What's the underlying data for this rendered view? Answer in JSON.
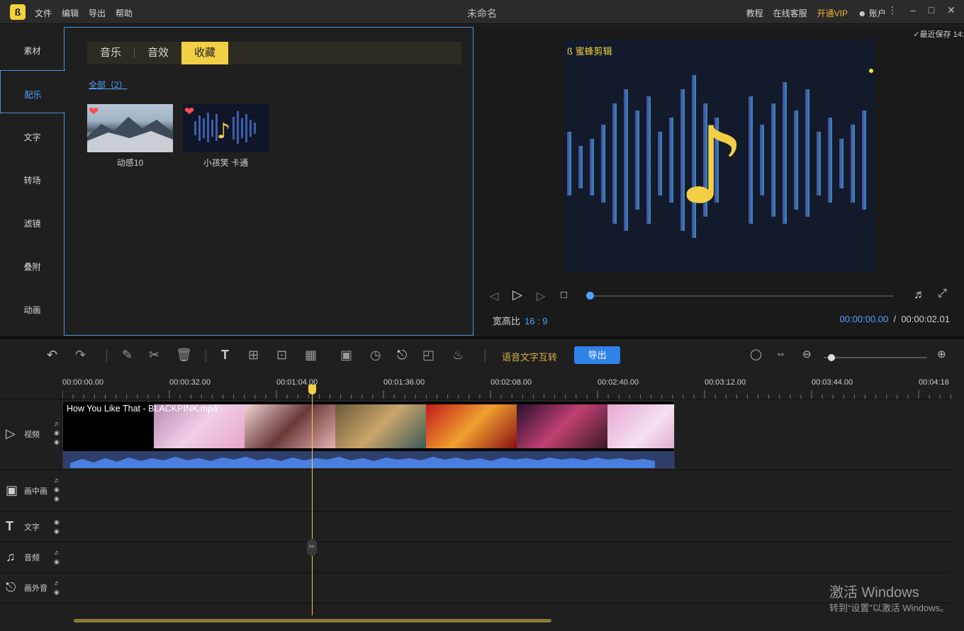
{
  "titlebar": {
    "menu": [
      "文件",
      "编辑",
      "导出",
      "帮助"
    ],
    "title": "未命名",
    "links": [
      "教程",
      "在线客服"
    ],
    "vip": "开通VIP",
    "account": "账户"
  },
  "sidenav": [
    "素材",
    "配乐",
    "文字",
    "转场",
    "滤镜",
    "叠附",
    "动画"
  ],
  "sidenav_active": "配乐",
  "tabs": [
    "音乐",
    "音效",
    "收藏"
  ],
  "tab_active": "收藏",
  "all_link": "全部（2）",
  "cards": [
    {
      "label": "动感10"
    },
    {
      "label": "小孩笑 卡通"
    }
  ],
  "preview": {
    "last_save": "最近保存 14:",
    "watermark": "蜜蜂剪辑",
    "aspect_label": "宽高比",
    "aspect_value": "16 : 9",
    "current_time": "00:00:00.00",
    "sep": "/",
    "total_time": "00:00:02.01"
  },
  "toolbar": {
    "speech_text": "语音文字互转",
    "export": "导出"
  },
  "ruler": [
    "00:00:00.00",
    "00:00:32.00",
    "00:01:04.00",
    "00:01:36.00",
    "00:02:08.00",
    "00:02:40.00",
    "00:03:12.00",
    "00:03:44.00",
    "00:04:16"
  ],
  "tracks": [
    {
      "label": "视频"
    },
    {
      "label": "画中画"
    },
    {
      "label": "文字"
    },
    {
      "label": "音频"
    },
    {
      "label": "画外音"
    }
  ],
  "clip": {
    "title": "How You Like That - BLACKPINK.mp4"
  },
  "activate": {
    "line1": "激活 Windows",
    "line2": "转到“设置”以激活 Windows。"
  },
  "colors": {
    "accent": "#4ea2ff",
    "highlight": "#f3cf45",
    "export": "#2f82e8",
    "vip": "#f0b23a"
  }
}
